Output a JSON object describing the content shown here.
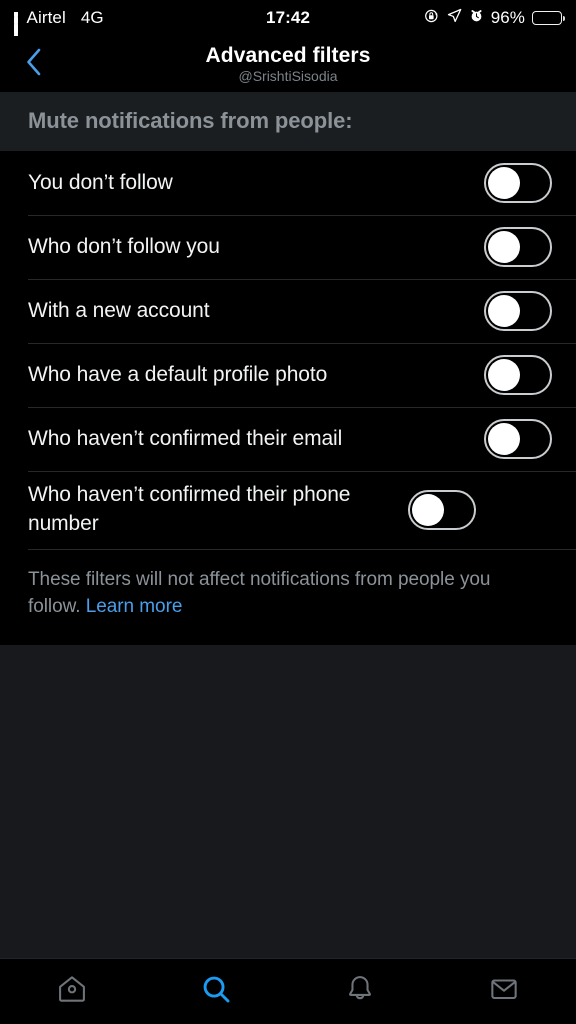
{
  "status_bar": {
    "signal_icon": "signal-bars-icon",
    "carrier": "Airtel",
    "network_type": "4G",
    "time": "17:42",
    "rotation_lock_icon": "rotation-lock-icon",
    "location_icon": "location-arrow-icon",
    "alarm_icon": "alarm-clock-icon",
    "battery_percent": "96%",
    "battery_icon": "battery-icon"
  },
  "header": {
    "back_icon": "chevron-left-icon",
    "title": "Advanced filters",
    "subtitle": "@SrishtiSisodia"
  },
  "section": {
    "title": "Mute notifications from people:"
  },
  "filters": [
    {
      "label": "You don’t follow",
      "enabled": false
    },
    {
      "label": "Who don’t follow you",
      "enabled": false
    },
    {
      "label": "With a new account",
      "enabled": false
    },
    {
      "label": "Who have a default profile photo",
      "enabled": false
    },
    {
      "label": "Who haven’t confirmed their email",
      "enabled": false
    },
    {
      "label": "Who haven’t confirmed their phone number",
      "enabled": false
    }
  ],
  "footer": {
    "note": "These filters will not affect notifications from people you follow.",
    "link_label": "Learn more"
  },
  "tab_bar": {
    "items": [
      {
        "name": "home",
        "icon": "home-icon",
        "active": false
      },
      {
        "name": "search",
        "icon": "search-icon",
        "active": true
      },
      {
        "name": "notifications",
        "icon": "bell-icon",
        "active": false
      },
      {
        "name": "messages",
        "icon": "envelope-icon",
        "active": false
      }
    ]
  },
  "colors": {
    "accent": "#1D9BF0",
    "link": "#4A9EEA",
    "background": "#000000",
    "surface": "#17191C",
    "section_background": "#1B1E21",
    "muted_text": "#8B9298",
    "primary_text": "#F2F3F4",
    "divider": "#26292C",
    "tab_inactive": "#6E7479"
  }
}
